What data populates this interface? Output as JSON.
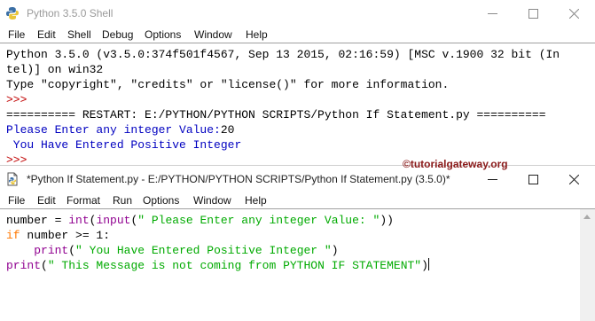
{
  "colors": {
    "output_blue": "#0000c0",
    "prompt_red": "#c00000",
    "keyword_orange": "#ff7700",
    "builtin_purple": "#900090",
    "string_green": "#00aa00",
    "watermark_red": "#8b1a1a"
  },
  "shell": {
    "title": "Python 3.5.0 Shell",
    "menu": [
      "File",
      "Edit",
      "Shell",
      "Debug",
      "Options",
      "Window",
      "Help"
    ],
    "banner1": "Python 3.5.0 (v3.5.0:374f501f4567, Sep 13 2015, 02:16:59) [MSC v.1900 32 bit (In",
    "banner2": "tel)] on win32",
    "banner3": "Type \"copyright\", \"credits\" or \"license()\" for more information.",
    "prompt": ">>>",
    "restart": "========== RESTART: E:/PYTHON/PYTHON SCRIPTS/Python If Statement.py ==========",
    "input_prompt": "Please Enter any integer Value:",
    "input_value": "20",
    "output": " You Have Entered Positive Integer"
  },
  "watermark": "©tutorialgateway.org",
  "editor": {
    "title": "*Python If Statement.py - E:/PYTHON/PYTHON SCRIPTS/Python If Statement.py (3.5.0)*",
    "menu": [
      "File",
      "Edit",
      "Format",
      "Run",
      "Options",
      "Window",
      "Help"
    ],
    "code": {
      "l1_a": "number = ",
      "l1_b": "int",
      "l1_c": "(",
      "l1_d": "input",
      "l1_e": "(",
      "l1_f": "\" Please Enter any integer Value: \"",
      "l1_g": "))",
      "l2_kw": "if",
      "l2_rest": " number >= 1:",
      "l3_indent": "    ",
      "l3_fn": "print",
      "l3_p1": "(",
      "l3_str": "\" You Have Entered Positive Integer \"",
      "l3_p2": ")",
      "l4_fn": "print",
      "l4_p1": "(",
      "l4_str": "\" This Message is not coming from PYTHON IF STATEMENT\"",
      "l4_p2": ")"
    }
  }
}
